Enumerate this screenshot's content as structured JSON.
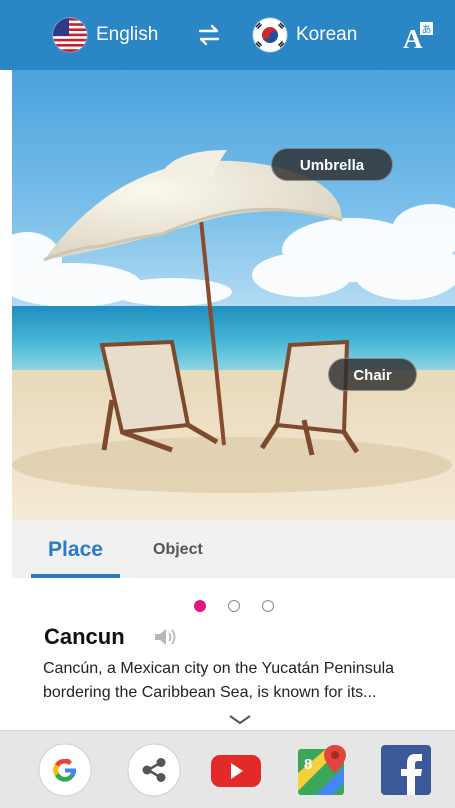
{
  "header": {
    "source_language": "English",
    "target_language": "Korean",
    "swap_icon": "swap-arrows-icon",
    "font_icon": "font-translate-icon",
    "color": "#2b86c6"
  },
  "photo": {
    "tags": [
      {
        "label": "Umbrella"
      },
      {
        "label": "Chair"
      }
    ]
  },
  "result": {
    "tabs": [
      {
        "label": "Place",
        "active": true
      },
      {
        "label": "Object",
        "active": false
      }
    ],
    "pager": {
      "count": 3,
      "active": 0,
      "active_color": "#e5147d"
    },
    "place_name": "Cancun",
    "description": "Cancún, a Mexican city on the Yucatán Peninsula bordering the Caribbean Sea, is known for its...",
    "speaker_icon": "speaker-icon",
    "expand_icon": "chevron-down-icon"
  },
  "share": {
    "apps": [
      "Google",
      "Share",
      "YouTube",
      "Maps",
      "Facebook"
    ]
  }
}
